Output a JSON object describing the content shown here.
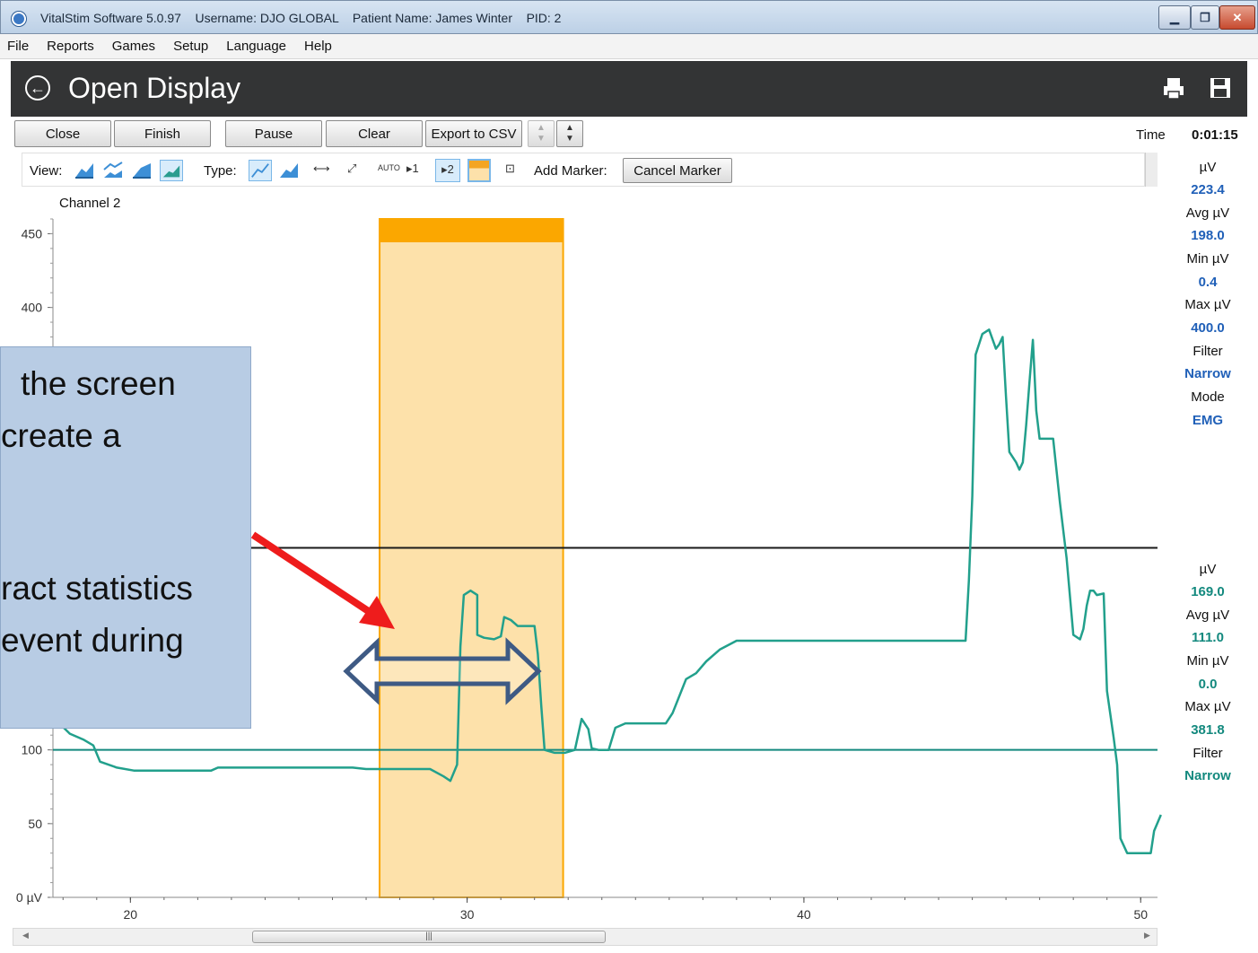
{
  "window": {
    "app_title": "VitalStim Software 5.0.97",
    "username": "Username: DJO GLOBAL",
    "patient": "Patient Name: James Winter",
    "pid": "PID: 2"
  },
  "menu": [
    "File",
    "Reports",
    "Games",
    "Setup",
    "Language",
    "Help"
  ],
  "header": {
    "title": "Open Display"
  },
  "buttons": {
    "close": "Close",
    "finish": "Finish",
    "pause": "Pause",
    "clear": "Clear",
    "export": "Export to CSV"
  },
  "time": {
    "label": "Time",
    "value": "0:01:15"
  },
  "toolbar": {
    "view_label": "View:",
    "type_label": "Type:",
    "marker1": "1",
    "marker2": "2",
    "auto": "AUTO",
    "add_marker_label": "Add Marker:",
    "cancel_marker": "Cancel Marker"
  },
  "stats_channel1": {
    "uv_label": "µV",
    "uv": "223.4",
    "avg_label": "Avg µV",
    "avg": "198.0",
    "min_label": "Min µV",
    "min": "0.4",
    "max_label": "Max µV",
    "max": "400.0",
    "filter_label": "Filter",
    "filter": "Narrow",
    "mode_label": "Mode",
    "mode": "EMG",
    "color": "#2060b8"
  },
  "stats_channel2": {
    "uv_label": "µV",
    "uv": "169.0",
    "avg_label": "Avg µV",
    "avg": "111.0",
    "min_label": "Min µV",
    "min": "0.0",
    "max_label": "Max µV",
    "max": "381.8",
    "filter_label": "Filter",
    "filter": "Narrow",
    "color": "#13897e"
  },
  "callout": {
    "line1": "the screen",
    "line2": "create a",
    "line3": "ract statistics",
    "line4": "event during"
  },
  "chart_data": {
    "type": "line",
    "channel_label": "Channel 2",
    "xlim": [
      17.7,
      50.5
    ],
    "ylim": [
      0,
      460
    ],
    "x_ticks": [
      20,
      30,
      40,
      50
    ],
    "y_ticks": [
      {
        "v": 0,
        "label": "0 µV"
      },
      {
        "v": 50,
        "label": "50"
      },
      {
        "v": 100,
        "label": "100"
      },
      {
        "v": 400,
        "label": "400"
      },
      {
        "v": 450,
        "label": "450"
      }
    ],
    "selection": {
      "x_start": 27.4,
      "x_end": 32.85,
      "color": "#fde1aa",
      "bar_color": "#fba700"
    },
    "threshold_lines": [
      {
        "y": 237,
        "color": "#1a1a1a"
      },
      {
        "y": 100,
        "color": "#13897e"
      }
    ],
    "series": [
      {
        "color": "#22a08c",
        "points": [
          [
            17.8,
            120
          ],
          [
            18.2,
            111
          ],
          [
            18.6,
            107
          ],
          [
            18.9,
            103
          ],
          [
            19.1,
            92
          ],
          [
            19.6,
            88
          ],
          [
            20.1,
            86
          ],
          [
            21.2,
            86
          ],
          [
            22.4,
            86
          ],
          [
            22.6,
            88
          ],
          [
            25.0,
            88
          ],
          [
            26.6,
            88
          ],
          [
            27.0,
            87
          ],
          [
            27.4,
            87
          ],
          [
            28.9,
            87
          ],
          [
            29.3,
            82
          ],
          [
            29.5,
            79
          ],
          [
            29.7,
            90
          ],
          [
            29.8,
            170
          ],
          [
            29.9,
            205
          ],
          [
            30.1,
            208
          ],
          [
            30.3,
            205
          ],
          [
            30.3,
            178
          ],
          [
            30.5,
            176
          ],
          [
            30.8,
            175
          ],
          [
            31.0,
            177
          ],
          [
            31.1,
            190
          ],
          [
            31.3,
            188
          ],
          [
            31.5,
            184
          ],
          [
            31.7,
            184
          ],
          [
            32.0,
            184
          ],
          [
            32.1,
            165
          ],
          [
            32.2,
            130
          ],
          [
            32.3,
            100
          ],
          [
            32.6,
            98
          ],
          [
            32.9,
            98
          ],
          [
            33.2,
            100
          ],
          [
            33.4,
            121
          ],
          [
            33.6,
            114
          ],
          [
            33.7,
            101
          ],
          [
            33.9,
            100
          ],
          [
            34.2,
            100
          ],
          [
            34.4,
            115
          ],
          [
            34.7,
            118
          ],
          [
            35.5,
            118
          ],
          [
            35.9,
            118
          ],
          [
            36.1,
            125
          ],
          [
            36.5,
            148
          ],
          [
            36.8,
            152
          ],
          [
            37.1,
            160
          ],
          [
            37.5,
            168
          ],
          [
            38.0,
            174
          ],
          [
            39.5,
            174
          ],
          [
            44.3,
            174
          ],
          [
            44.8,
            174
          ],
          [
            44.9,
            215
          ],
          [
            45.0,
            272
          ],
          [
            45.1,
            368
          ],
          [
            45.3,
            382
          ],
          [
            45.5,
            385
          ],
          [
            45.7,
            372
          ],
          [
            45.8,
            375
          ],
          [
            45.9,
            380
          ],
          [
            46.0,
            340
          ],
          [
            46.1,
            302
          ],
          [
            46.3,
            295
          ],
          [
            46.4,
            290
          ],
          [
            46.5,
            295
          ],
          [
            46.6,
            320
          ],
          [
            46.7,
            350
          ],
          [
            46.8,
            378
          ],
          [
            46.9,
            330
          ],
          [
            47.0,
            311
          ],
          [
            47.3,
            311
          ],
          [
            47.4,
            311
          ],
          [
            47.6,
            268
          ],
          [
            47.8,
            230
          ],
          [
            48.0,
            178
          ],
          [
            48.2,
            175
          ],
          [
            48.3,
            182
          ],
          [
            48.4,
            198
          ],
          [
            48.5,
            208
          ],
          [
            48.6,
            208
          ],
          [
            48.7,
            205
          ],
          [
            48.9,
            206
          ],
          [
            49.0,
            140
          ],
          [
            49.2,
            108
          ],
          [
            49.3,
            90
          ],
          [
            49.4,
            40
          ],
          [
            49.6,
            30
          ],
          [
            49.8,
            30
          ],
          [
            50.1,
            30
          ],
          [
            50.3,
            30
          ],
          [
            50.4,
            45
          ],
          [
            50.6,
            56
          ]
        ]
      }
    ]
  }
}
